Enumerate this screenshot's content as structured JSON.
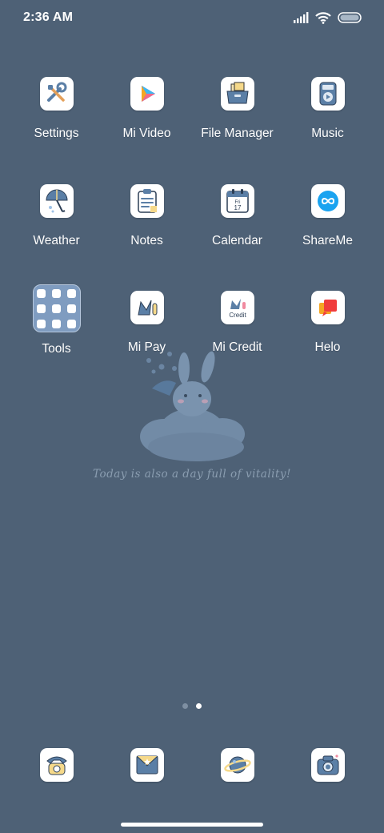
{
  "status_bar": {
    "time": "2:36 AM",
    "icons": [
      "signal-icon",
      "wifi-icon",
      "battery-icon"
    ]
  },
  "apps": [
    {
      "name": "Settings",
      "icon": "wrench-screwdriver-icon"
    },
    {
      "name": "Mi Video",
      "icon": "play-icon"
    },
    {
      "name": "File Manager",
      "icon": "folder-box-icon"
    },
    {
      "name": "Music",
      "icon": "music-player-icon"
    },
    {
      "name": "Weather",
      "icon": "umbrella-icon"
    },
    {
      "name": "Notes",
      "icon": "notepad-icon"
    },
    {
      "name": "Calendar",
      "icon": "calendar-icon"
    },
    {
      "name": "ShareMe",
      "icon": "infinity-icon"
    },
    {
      "name": "Tools",
      "icon": "folder-grid-icon"
    },
    {
      "name": "Mi Pay",
      "icon": "mi-pay-icon"
    },
    {
      "name": "Mi Credit",
      "icon": "mi-credit-icon"
    },
    {
      "name": "Helo",
      "icon": "helo-icon"
    }
  ],
  "calendar_icon": {
    "day": "Fri",
    "date": "17"
  },
  "credit_icon_text": "Credit",
  "widget": {
    "tagline": "Today is also a day full of vitality!"
  },
  "page_indicator": {
    "pages": 2,
    "current": 2
  },
  "dock": [
    {
      "icon": "telephone-icon"
    },
    {
      "icon": "envelope-icon"
    },
    {
      "icon": "planet-icon"
    },
    {
      "icon": "camera-icon"
    }
  ],
  "colors": {
    "wallpaper": "#4e6176",
    "icon_accent": "#5b7fa6"
  }
}
